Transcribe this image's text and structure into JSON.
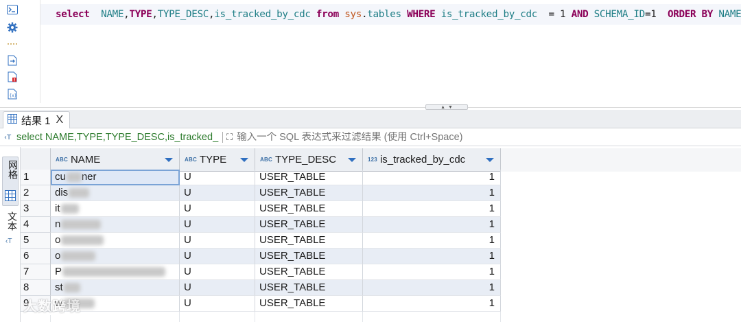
{
  "editor": {
    "sql_tokens": [
      {
        "t": "select",
        "c": "kw"
      },
      {
        "t": "  ",
        "c": "op"
      },
      {
        "t": "NAME",
        "c": "id"
      },
      {
        "t": ",",
        "c": "op"
      },
      {
        "t": "TYPE",
        "c": "kw"
      },
      {
        "t": ",",
        "c": "op"
      },
      {
        "t": "TYPE_DESC",
        "c": "id"
      },
      {
        "t": ",",
        "c": "op"
      },
      {
        "t": "is_tracked_by_cdc",
        "c": "id"
      },
      {
        "t": " ",
        "c": "op"
      },
      {
        "t": "from",
        "c": "kw"
      },
      {
        "t": " ",
        "c": "op"
      },
      {
        "t": "sys",
        "c": "sch"
      },
      {
        "t": ".",
        "c": "op"
      },
      {
        "t": "tables",
        "c": "id"
      },
      {
        "t": " ",
        "c": "op"
      },
      {
        "t": "WHERE",
        "c": "kw"
      },
      {
        "t": " ",
        "c": "op"
      },
      {
        "t": "is_tracked_by_cdc",
        "c": "id"
      },
      {
        "t": "  = ",
        "c": "op"
      },
      {
        "t": "1",
        "c": "num"
      },
      {
        "t": " ",
        "c": "op"
      },
      {
        "t": "AND",
        "c": "kw"
      },
      {
        "t": " ",
        "c": "op"
      },
      {
        "t": "SCHEMA_ID",
        "c": "id"
      },
      {
        "t": "=",
        "c": "op"
      },
      {
        "t": "1",
        "c": "num"
      },
      {
        "t": "  ",
        "c": "op"
      },
      {
        "t": "ORDER BY",
        "c": "kw"
      },
      {
        "t": " ",
        "c": "op"
      },
      {
        "t": "NAME",
        "c": "id"
      },
      {
        "t": ";",
        "c": "op"
      }
    ],
    "gutter_icons": [
      "terminal-icon",
      "settings-gear-icon",
      "more-dots-icon",
      "export-script-icon",
      "error-file-icon",
      "variables-icon"
    ]
  },
  "results": {
    "tab_label": "结果 1",
    "close_glyph": "X",
    "filter_query": "select NAME,TYPE,TYPE_DESC,is_tracked_",
    "filter_placeholder": "输入一个 SQL 表达式来过滤结果 (使用 Ctrl+Space)",
    "side_tabs": {
      "grid": "网格",
      "text": "文本"
    },
    "columns": [
      {
        "type": "ABC",
        "label": "NAME"
      },
      {
        "type": "ABC",
        "label": "TYPE"
      },
      {
        "type": "ABC",
        "label": "TYPE_DESC"
      },
      {
        "type": "123",
        "label": "is_tracked_by_cdc"
      }
    ],
    "rows": [
      {
        "n": "1",
        "name_prefix": "cu",
        "name_suffix": "ner",
        "type": "U",
        "desc": "USER_TABLE",
        "cdc": "1"
      },
      {
        "n": "2",
        "name_prefix": "dis",
        "name_suffix": "",
        "type": "U",
        "desc": "USER_TABLE",
        "cdc": "1"
      },
      {
        "n": "3",
        "name_prefix": "it",
        "name_suffix": "",
        "type": "U",
        "desc": "USER_TABLE",
        "cdc": "1"
      },
      {
        "n": "4",
        "name_prefix": "n",
        "name_suffix": "",
        "type": "U",
        "desc": "USER_TABLE",
        "cdc": "1"
      },
      {
        "n": "5",
        "name_prefix": "o",
        "name_suffix": "",
        "type": "U",
        "desc": "USER_TABLE",
        "cdc": "1"
      },
      {
        "n": "6",
        "name_prefix": "o",
        "name_suffix": "",
        "type": "U",
        "desc": "USER_TABLE",
        "cdc": "1"
      },
      {
        "n": "7",
        "name_prefix": "P",
        "name_suffix": "",
        "type": "U",
        "desc": "USER_TABLE",
        "cdc": "1"
      },
      {
        "n": "8",
        "name_prefix": "st",
        "name_suffix": "",
        "type": "U",
        "desc": "USER_TABLE",
        "cdc": "1"
      },
      {
        "n": "9",
        "name_prefix": "w",
        "name_suffix": "",
        "type": "U",
        "desc": "USER_TABLE",
        "cdc": "1"
      }
    ]
  },
  "watermark": {
    "text": "大数跨境"
  },
  "colors": {
    "keyword": "#8b0058",
    "identifier": "#1f7e86",
    "schema": "#c0561e",
    "accent": "#2f6fc0",
    "alt_row": "#e8edf5"
  }
}
